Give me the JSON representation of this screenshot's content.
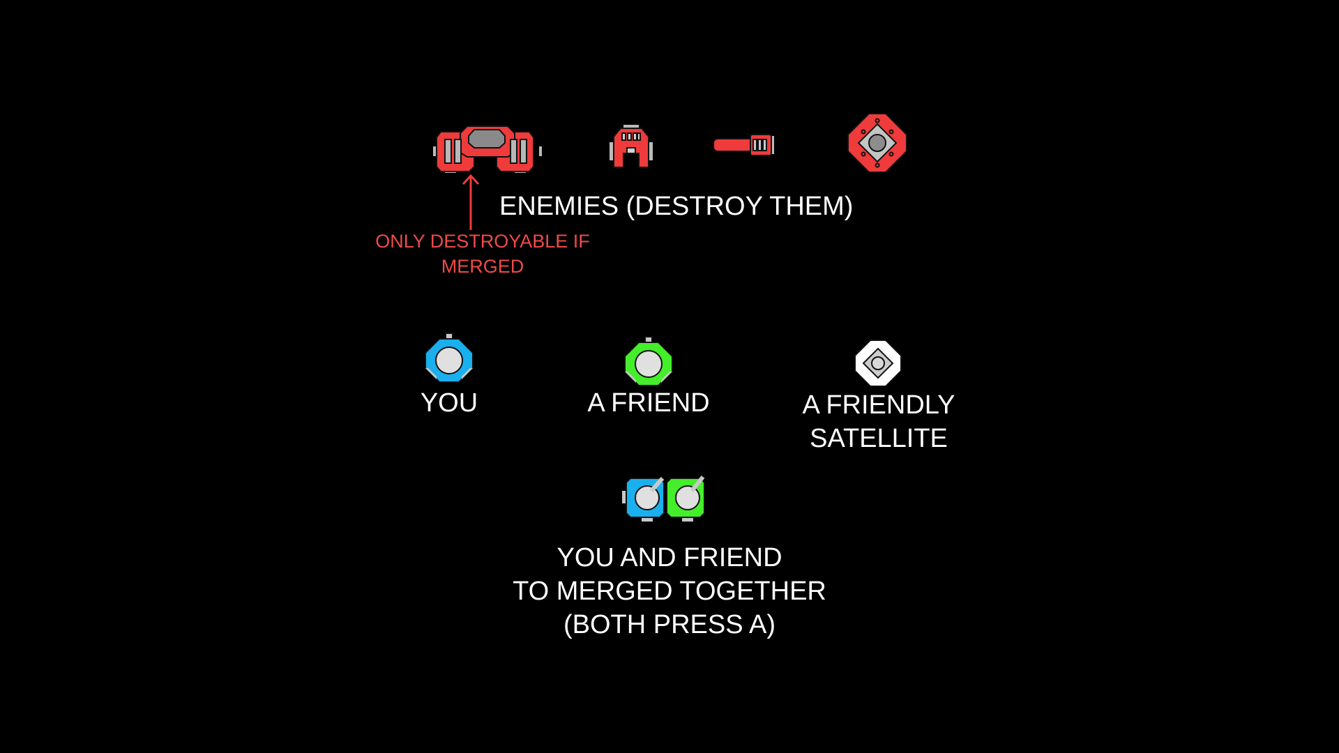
{
  "enemies": {
    "heading": "ENEMIES (DESTROY THEM)",
    "note_line1": "ONLY DESTROYABLE IF",
    "note_line2": "MERGED",
    "sprites": [
      "heavy-ship-icon",
      "small-ship-icon",
      "missile-icon",
      "mine-icon"
    ]
  },
  "allies": {
    "you": "YOU",
    "friend": "A FRIEND",
    "satellite_line1": "A FRIENDLY",
    "satellite_line2": "SATELLITE"
  },
  "merged": {
    "line1": "YOU AND FRIEND",
    "line2": "TO MERGED TOGETHER",
    "line3": "(BOTH PRESS A)"
  },
  "colors": {
    "background": "#000000",
    "enemy": "#ef3b3b",
    "you": "#1ab0ee",
    "friend": "#44ee2a",
    "satellite": "#ffffff",
    "text": "#ffffff",
    "note": "#ef4a4a"
  }
}
